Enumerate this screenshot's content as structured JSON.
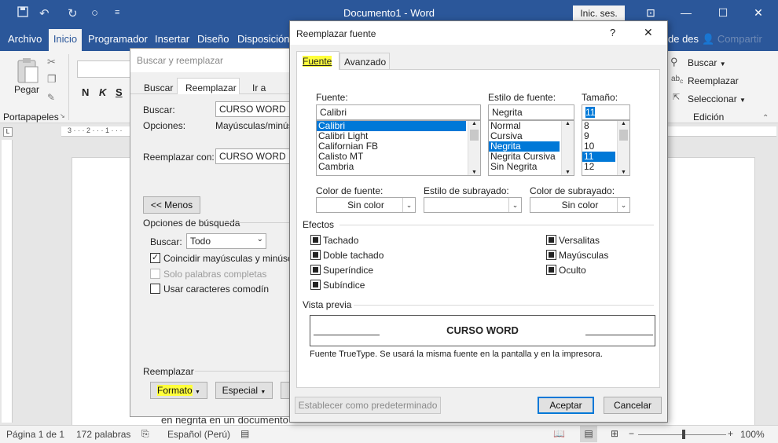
{
  "titlebar": {
    "doc_title": "Documento1  -  Word",
    "signin": "Inic. ses.",
    "icons": [
      "save-icon",
      "undo-icon",
      "redo-icon",
      "circle-icon",
      "customize-icon"
    ]
  },
  "ribbon_tabs": [
    "Archivo",
    "Inicio",
    "Programador",
    "Insertar",
    "Diseño",
    "Disposición",
    "de des",
    "Compartir"
  ],
  "ribbon": {
    "paste_label": "Pegar",
    "clipboard_group": "Portapapeles",
    "editing_group": "Edición",
    "find": "Buscar",
    "replace": "Reemplazar",
    "select": "Seleccionar",
    "font_bold": "N",
    "font_italic": "K",
    "font_underline": "S"
  },
  "ruler": "3 · · · 2 · · · 1 · · ·",
  "document": {
    "text": "en negrita en un documento"
  },
  "statusbar": {
    "page": "Página 1 de 1",
    "words": "172 palabras",
    "language": "Español (Perú)",
    "zoom": "100%"
  },
  "find_replace": {
    "title": "Buscar y reemplazar",
    "tabs": [
      "Buscar",
      "Reemplazar",
      "Ir a"
    ],
    "find_label": "Buscar:",
    "find_value": "CURSO WORD",
    "options_label": "Opciones:",
    "options_value": "Mayúsculas/minús",
    "replace_label": "Reemplazar con:",
    "replace_value": "CURSO WORD",
    "less_button": "<< Menos",
    "search_options_title": "Opciones de búsqueda",
    "search_label": "Buscar:",
    "search_value": "Todo",
    "opt_match_case": "Coincidir mayúsculas y minúscu",
    "opt_whole_words": "Solo palabras completas",
    "opt_wildcards": "Usar caracteres comodín",
    "replace_section": "Reemplazar",
    "format_button": "Formato",
    "special_button": "Especial"
  },
  "font_dialog": {
    "title": "Reemplazar fuente",
    "help": "?",
    "close": "✕",
    "tab_font": "Fuente",
    "tab_advanced": "Avanzado",
    "font_label": "Fuente:",
    "font_value": "Calibri",
    "font_list": [
      "Calibri",
      "Calibri Light",
      "Californian FB",
      "Calisto MT",
      "Cambria"
    ],
    "style_label": "Estilo de fuente:",
    "style_value": "Negrita",
    "style_list": [
      "Normal",
      "Cursiva",
      "Negrita",
      "Negrita Cursiva",
      "Sin Negrita"
    ],
    "size_label": "Tamaño:",
    "size_value": "11",
    "size_list": [
      "8",
      "9",
      "10",
      "11",
      "12"
    ],
    "font_color_label": "Color de fuente:",
    "font_color_value": "Sin color",
    "underline_style_label": "Estilo de subrayado:",
    "underline_style_value": "",
    "underline_color_label": "Color de subrayado:",
    "underline_color_value": "Sin color",
    "effects_title": "Efectos",
    "effects_left": [
      "Tachado",
      "Doble tachado",
      "Superíndice",
      "Subíndice"
    ],
    "effects_right": [
      "Versalitas",
      "Mayúsculas",
      "Oculto"
    ],
    "preview_title": "Vista previa",
    "preview_text": "CURSO WORD",
    "preview_note": "Fuente TrueType. Se usará la misma fuente en la pantalla y en la impresora.",
    "default_button": "Establecer como predeterminado",
    "ok_button": "Aceptar",
    "cancel_button": "Cancelar"
  },
  "colors": {
    "word_blue": "#2b579a",
    "selection": "#0078d7",
    "highlight": "#ffff3b"
  }
}
